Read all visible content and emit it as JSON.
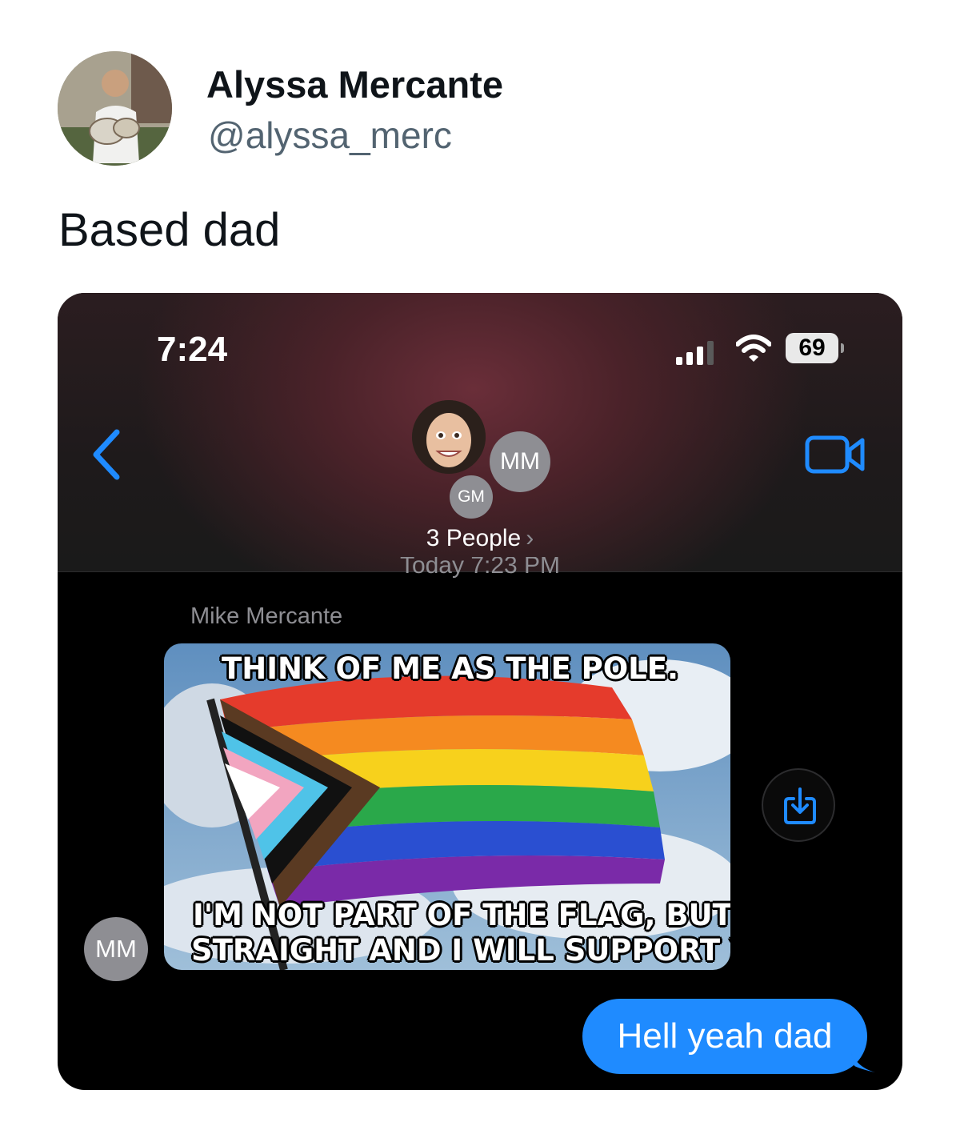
{
  "tweet": {
    "author_name": "Alyssa Mercante",
    "author_handle": "@alyssa_merc",
    "text": "Based dad"
  },
  "screenshot": {
    "status_bar": {
      "time": "7:24",
      "battery": "69"
    },
    "conversation": {
      "member_initials": [
        "MM",
        "GM"
      ],
      "people_label": "3 People",
      "timestamp": "Today 7:23 PM",
      "sender_name": "Mike Mercante",
      "sender_initials": "MM"
    },
    "meme": {
      "top_text": "THINK OF ME AS THE POLE.",
      "bottom_line_1": "I'M NOT PART OF THE FLAG, BUT I AM",
      "bottom_line_2": "STRAIGHT AND I WILL SUPPORT YOU."
    },
    "reply": {
      "text": "Hell yeah dad"
    },
    "colors": {
      "accent_blue": "#1f8bff",
      "bubble_blue": "#1f8bff",
      "header_maroon": "#6a2e39"
    },
    "icons": [
      "back-chevron-icon",
      "video-camera-icon",
      "signal-icon",
      "wifi-icon",
      "battery-icon",
      "save-download-icon"
    ]
  }
}
